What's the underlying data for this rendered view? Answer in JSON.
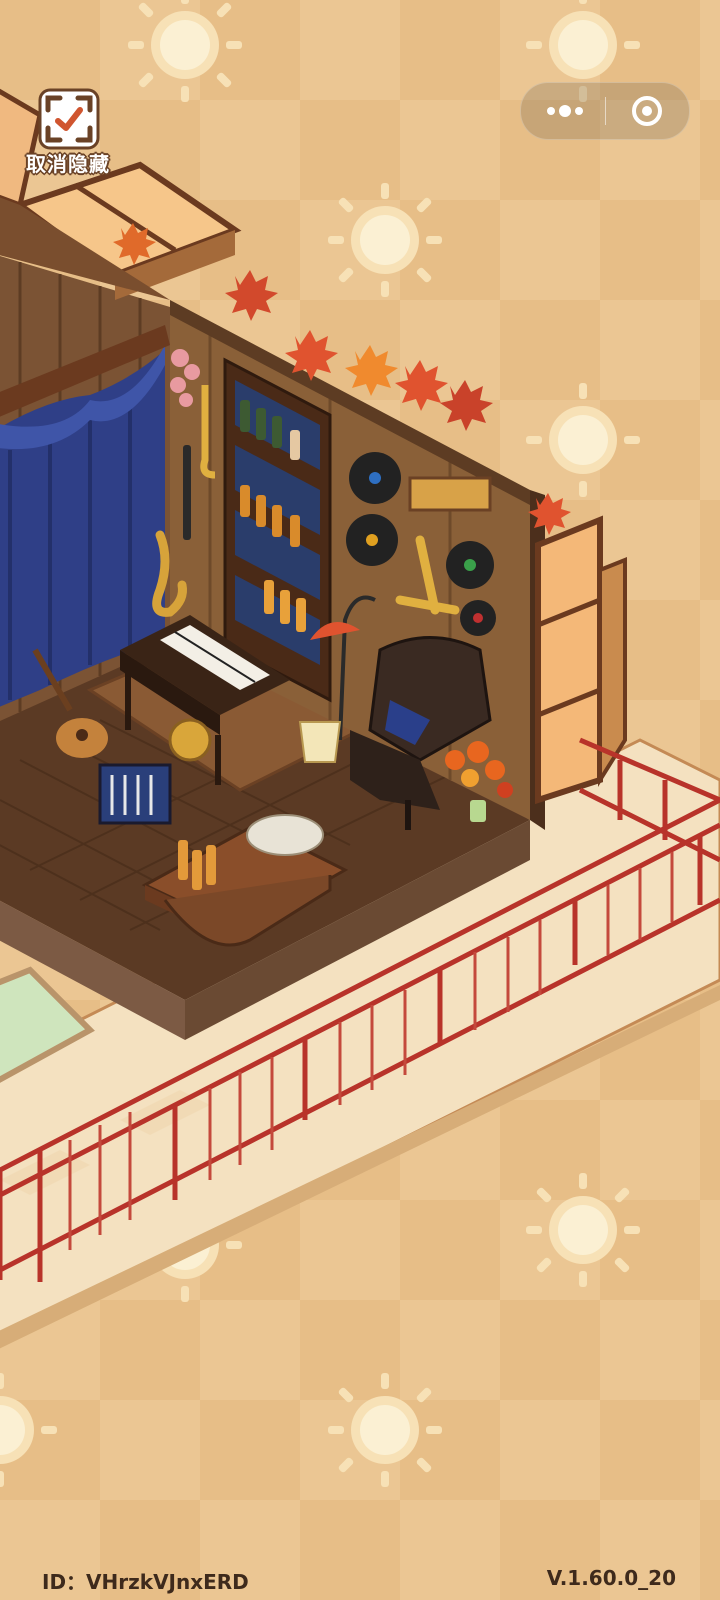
{
  "hide_button": {
    "label": "取消隐藏",
    "icon": "scan-frame-icon"
  },
  "capsule": {
    "more_icon": "more-dots-icon",
    "close_icon": "target-circle-icon"
  },
  "footer": {
    "id_text": "ID：VHrzkVJnxERD",
    "version": "V.1.60.0_20"
  },
  "colors": {
    "background": "#e7be87",
    "wall": "#6a4a33",
    "railing": "#c0392b",
    "floor": "#5a3a24",
    "terrace": "#f3dfbf",
    "curtain": "#2f3f87"
  }
}
